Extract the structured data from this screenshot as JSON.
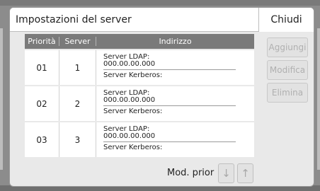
{
  "dialog": {
    "title": "Impostazioni del server",
    "close_label": "Chiudi"
  },
  "table": {
    "headers": [
      "Priorità",
      "Server",
      "Indirizzo"
    ],
    "rows": [
      {
        "priority": "01",
        "server": "1",
        "ldap_label": "Server LDAP:",
        "ldap_address": "000.00.00.000",
        "kerberos_label": "Server Kerberos:"
      },
      {
        "priority": "02",
        "server": "2",
        "ldap_label": "Server LDAP:",
        "ldap_address": "000.00.00.000",
        "kerberos_label": "Server Kerberos:"
      },
      {
        "priority": "03",
        "server": "3",
        "ldap_label": "Server LDAP:",
        "ldap_address": "000.00.00.000",
        "kerberos_label": "Server Kerberos:"
      }
    ]
  },
  "actions": {
    "add_label": "Aggiungi",
    "edit_label": "Modifica",
    "delete_label": "Elimina"
  },
  "priority_control": {
    "label": "Mod. prior",
    "down_icon": "↓",
    "up_icon": "↑"
  }
}
